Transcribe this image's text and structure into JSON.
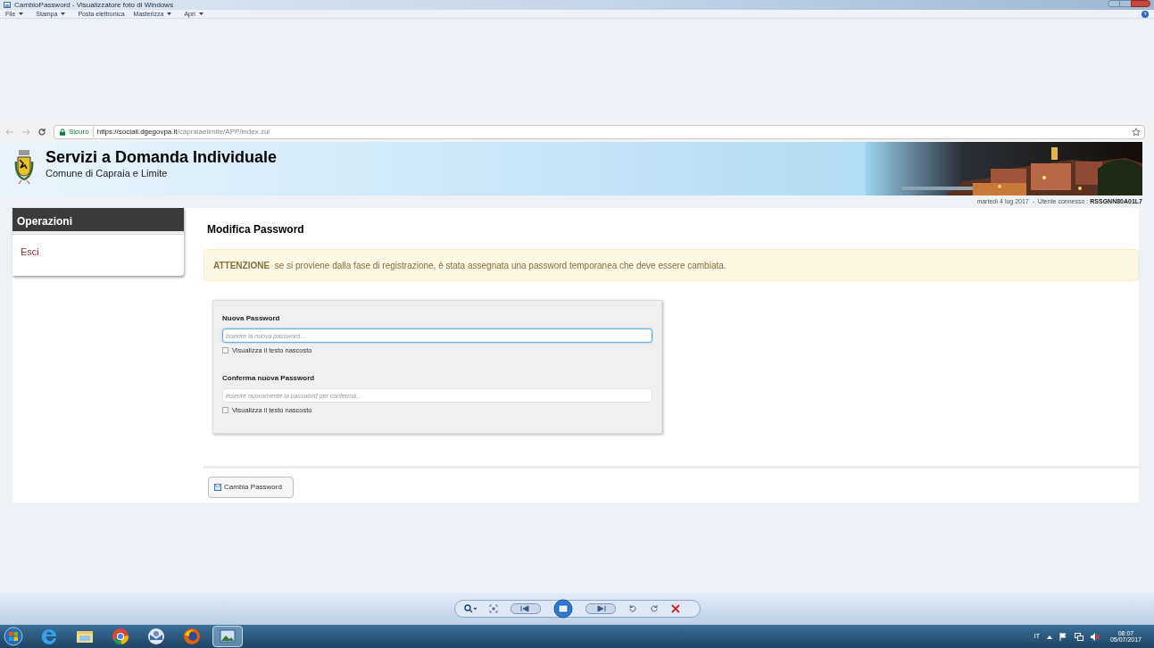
{
  "window": {
    "title": "CambioPassword - Visualizzatore foto di Windows"
  },
  "menu": [
    {
      "label": "File",
      "dropdown": true
    },
    {
      "label": "Stampa",
      "dropdown": true
    },
    {
      "label": "Posta elettronica",
      "dropdown": false
    },
    {
      "label": "Masterizza",
      "dropdown": true
    },
    {
      "label": "Apri",
      "dropdown": true
    }
  ],
  "browser": {
    "secure_label": "Sicuro",
    "url_host": "https://sociali.dgegovpa.it",
    "url_path": "/capraiaelimite/APP/index.zul"
  },
  "header": {
    "title": "Servizi a Domanda Individuale",
    "subtitle": "Comune di Capraia e Limite",
    "status": "martedì 4 lug 2017  -  Utente connesso : ",
    "user": "RSSGNN80A01L7"
  },
  "sidebar": {
    "title": "Operazioni",
    "items": [
      {
        "label": "Esci"
      }
    ]
  },
  "page": {
    "title": "Modifica Password",
    "alert": {
      "label": "ATTENZIONE",
      "text": "se si proviene dalla fase di registrazione, è stata assegnata una password temporanea che deve essere cambiata."
    }
  },
  "fields": [
    {
      "label": "Nuova Password",
      "placeholder": "inserire la nuova password...",
      "focused": true,
      "toggle": {
        "label": "Visualizza il testo nascosto",
        "checked": false
      }
    },
    {
      "label": "Conferma nuova Password",
      "placeholder": "inserire nuovamente la password per conferma...",
      "focused": false,
      "toggle": {
        "label": "Visualizza il testo nascosto",
        "checked": false
      }
    }
  ],
  "submit": {
    "label": "Cambia Password"
  },
  "taskbar": {
    "apps": [
      {
        "kind": "ie",
        "selected": false
      },
      {
        "kind": "folder",
        "selected": false
      },
      {
        "kind": "chrome",
        "selected": false
      },
      {
        "kind": "mail",
        "selected": false
      },
      {
        "kind": "firefox",
        "selected": false
      },
      {
        "kind": "photos",
        "selected": true
      }
    ],
    "language": "IT",
    "time": "08:07",
    "date": "05/07/2017"
  }
}
